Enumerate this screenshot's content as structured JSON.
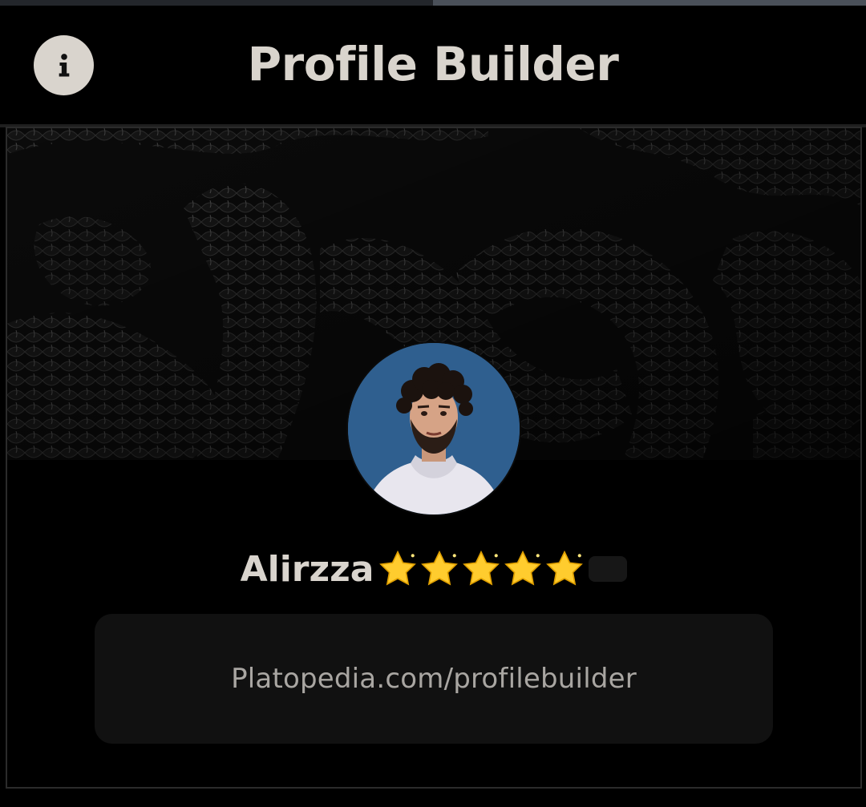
{
  "header": {
    "title": "Profile Builder",
    "info_icon": "info-icon"
  },
  "top_progress": {
    "value": 0.5
  },
  "profile": {
    "name": "Alirzza",
    "rating_stars": 5,
    "star_icon": "star-icon",
    "link": "Platopedia.com/profilebuilder"
  },
  "colors": {
    "background": "#000000",
    "title": "#d9d4cd",
    "link_box": "#111111",
    "link_text": "#a9a6a2",
    "avatar_bg": "#2f5f8f",
    "star": "#ffcc2e"
  }
}
